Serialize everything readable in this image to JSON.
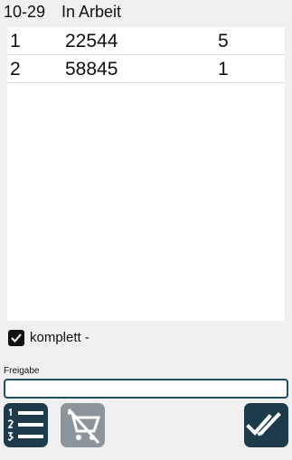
{
  "header": {
    "id": "10-29",
    "status": "In Arbeit"
  },
  "list": {
    "rows": [
      {
        "pos": "1",
        "article": "22544",
        "qty": "5"
      },
      {
        "pos": "2",
        "article": "58845",
        "qty": "1"
      }
    ]
  },
  "complete": {
    "label": "komplett -",
    "checked": true
  },
  "freigabe": {
    "label": "Freigabe",
    "value": ""
  },
  "buttons": {
    "list_icon": "numbered-list-icon",
    "cart_icon": "cart-disabled-icon",
    "done_icon": "double-check-icon"
  },
  "colors": {
    "accent": "#1d3b4a",
    "disabled": "#8c959b",
    "input_border": "#1f4f63"
  }
}
